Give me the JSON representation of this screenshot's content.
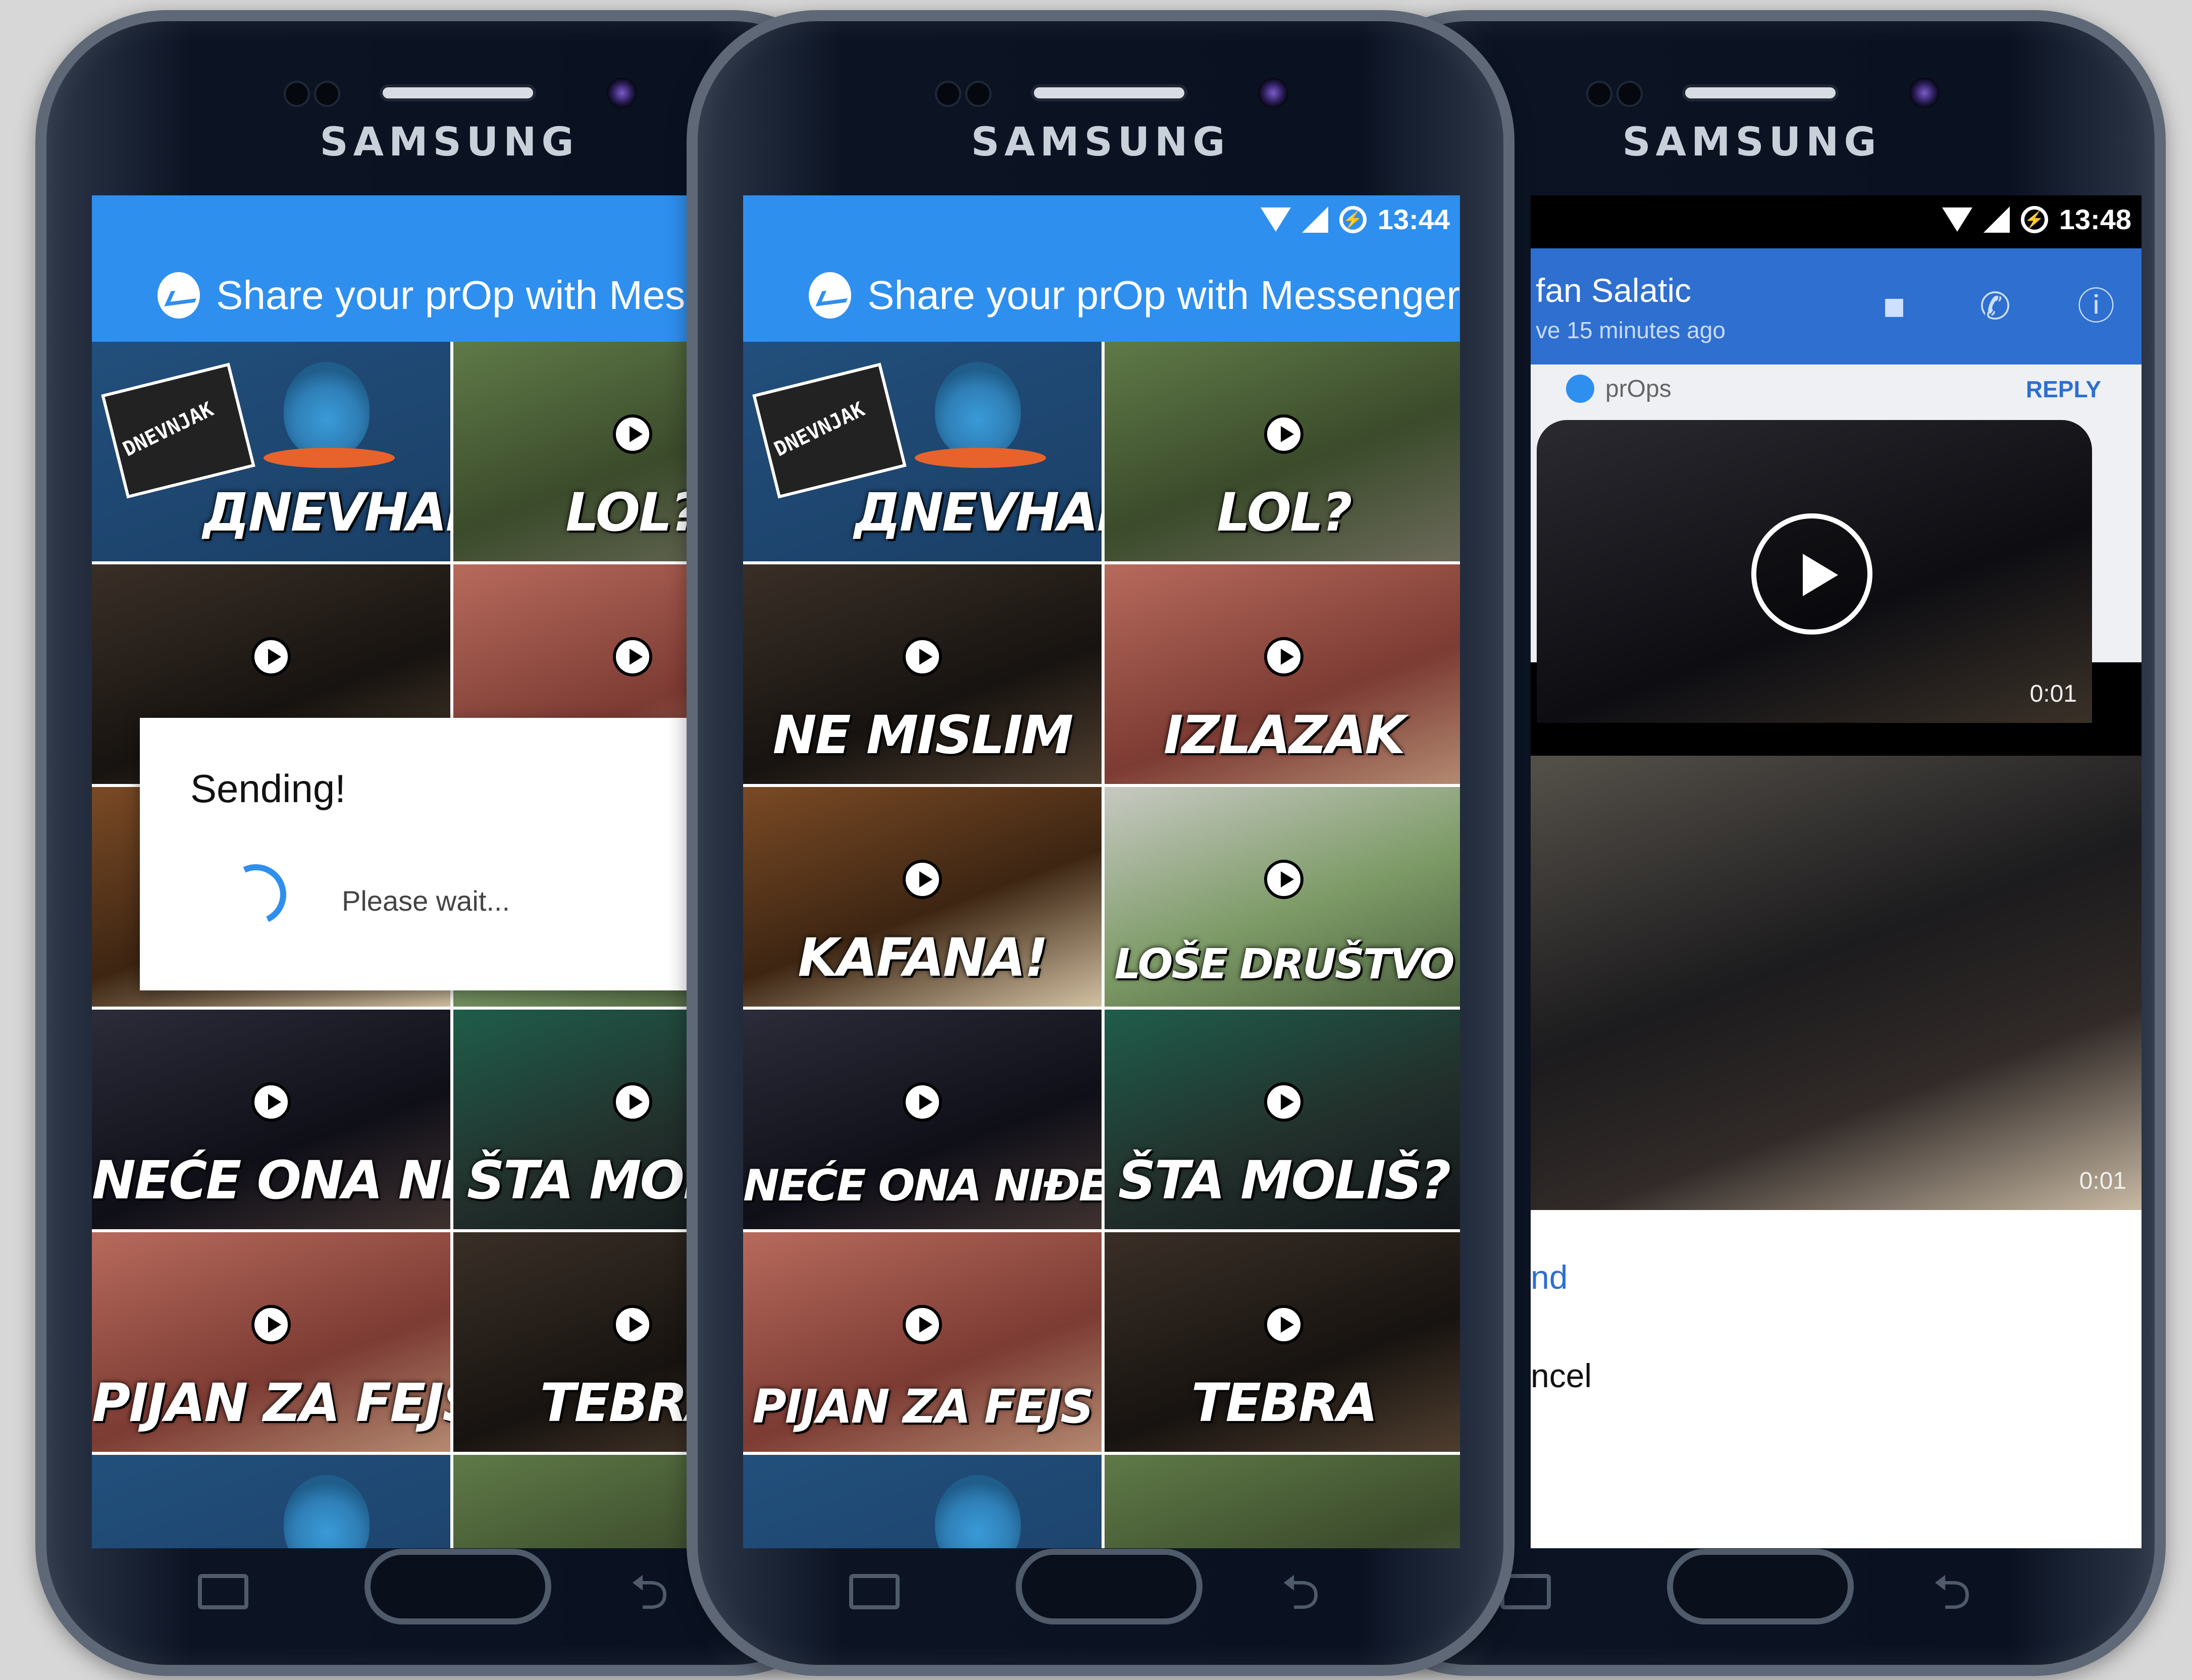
{
  "brand": "SAMSUNG",
  "phone1": {
    "share_title": "Share your prOp with Messenger",
    "dialog": {
      "title": "Sending!",
      "message": "Please wait..."
    },
    "tiles": [
      "ДNEVHAK",
      "LOL?",
      "",
      "",
      "",
      "",
      "NEĆE ONA NIĐE",
      "ŠTA MOLIŠ?",
      "PIJAN ZA FEJS",
      "TEBRA",
      "",
      ""
    ]
  },
  "phone2": {
    "status_time": "13:44",
    "share_title": "Share your prOp with Messenger",
    "tiles": [
      "ДNEVHAK",
      "LOL?",
      "NE MISLIM",
      "IZLAZAK",
      "KAFANA!",
      "LOŠE DRUŠTVO",
      "NEĆE ONA NIĐE",
      "ŠTA MOLIŠ?",
      "PIJAN ZA FEJS",
      "TEBRA",
      "",
      ""
    ]
  },
  "phone3": {
    "status_time": "13:48",
    "contact_name": "fan Salatic",
    "contact_status": "ve 15 minutes ago",
    "props_label": "prOps",
    "reply_label": "REPLY",
    "video_duration": "0:01",
    "preview_duration": "0:01",
    "send_label": "nd",
    "cancel_label": "ncel"
  },
  "icons": [
    "messenger-icon",
    "wifi-icon",
    "signal-icon",
    "battery-icon",
    "play-icon",
    "video-call-icon",
    "phone-hd-icon",
    "info-icon",
    "recent-apps-icon",
    "back-icon"
  ],
  "colors": {
    "accent": "#2e8fef",
    "header_dark": "#2e6fd0"
  }
}
